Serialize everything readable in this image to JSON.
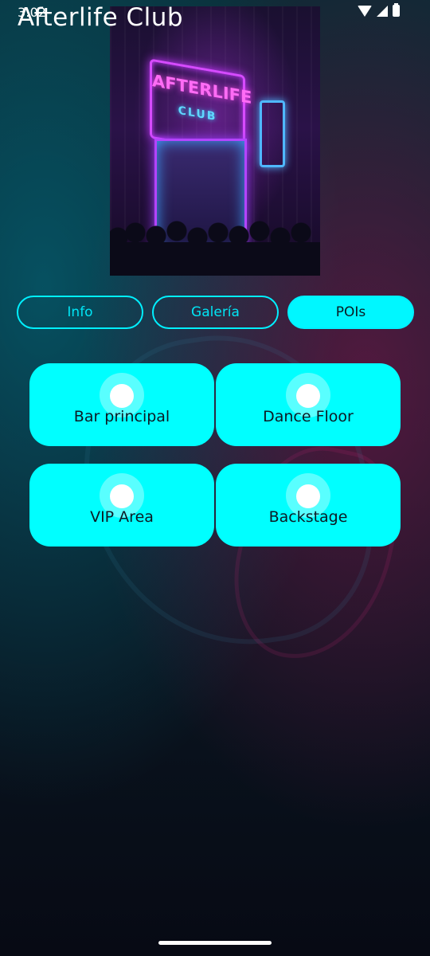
{
  "status_bar": {
    "time": "3:02"
  },
  "app": {
    "title": "Afterlife Club"
  },
  "hero": {
    "sign_text": "AFTERLIFE",
    "sign_sub": "CLUB"
  },
  "tabs": [
    {
      "label": "Info",
      "selected": false
    },
    {
      "label": "Galería",
      "selected": false
    },
    {
      "label": "POIs",
      "selected": true
    }
  ],
  "pois": [
    {
      "label": "Bar principal"
    },
    {
      "label": "Dance Floor"
    },
    {
      "label": "VIP Area"
    },
    {
      "label": "Backstage"
    }
  ],
  "colors": {
    "accent": "#00ffff",
    "neon_pink": "#d64bff",
    "text_dark": "#0d1a24"
  },
  "icons": [
    "wifi-icon",
    "signal-icon",
    "battery-icon",
    "location-dot-icon"
  ]
}
